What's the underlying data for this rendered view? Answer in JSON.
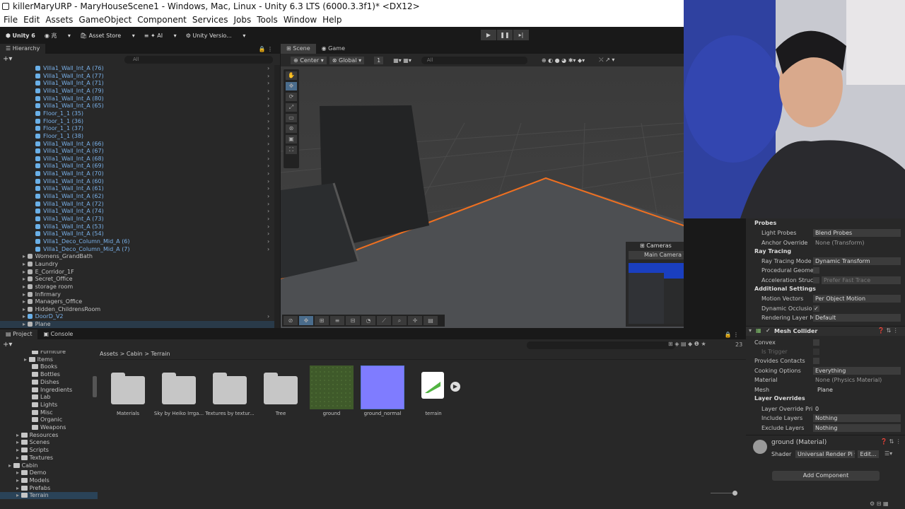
{
  "window": {
    "title": "killerMaryURP - MaryHouseScene1 - Windows, Mac, Linux - Unity 6.3 LTS (6000.3.3f1)* <DX12>"
  },
  "menu": [
    "File",
    "Edit",
    "Assets",
    "GameObject",
    "Component",
    "Services",
    "Jobs",
    "Tools",
    "Window",
    "Help"
  ],
  "toolbar": {
    "unity": "Unity 6",
    "account": "兆",
    "store": "Asset Store",
    "ai": "AI",
    "vcs": "Unity Versio..."
  },
  "hierarchy": {
    "tab": "Hierarchy",
    "search_placeholder": "All",
    "rows": [
      {
        "label": "Villa1_Wall_Int_A (76)",
        "type": "prefab"
      },
      {
        "label": "Villa1_Wall_Int_A (77)",
        "type": "prefab"
      },
      {
        "label": "Villa1_Wall_Int_A (71)",
        "type": "prefab"
      },
      {
        "label": "Villa1_Wall_Int_A (79)",
        "type": "prefab"
      },
      {
        "label": "Villa1_Wall_Int_A (80)",
        "type": "prefab"
      },
      {
        "label": "Villa1_Wall_Int_A (65)",
        "type": "prefab"
      },
      {
        "label": "Floor_1_1 (35)",
        "type": "prefab"
      },
      {
        "label": "Floor_1_1 (36)",
        "type": "prefab"
      },
      {
        "label": "Floor_1_1 (37)",
        "type": "prefab"
      },
      {
        "label": "Floor_1_1 (38)",
        "type": "prefab"
      },
      {
        "label": "Villa1_Wall_Int_A (66)",
        "type": "prefab"
      },
      {
        "label": "Villa1_Wall_Int_A (67)",
        "type": "prefab"
      },
      {
        "label": "Villa1_Wall_Int_A (68)",
        "type": "prefab"
      },
      {
        "label": "Villa1_Wall_Int_A (69)",
        "type": "prefab"
      },
      {
        "label": "Villa1_Wall_Int_A (70)",
        "type": "prefab"
      },
      {
        "label": "Villa1_Wall_Int_A (60)",
        "type": "prefab"
      },
      {
        "label": "Villa1_Wall_Int_A (61)",
        "type": "prefab"
      },
      {
        "label": "Villa1_Wall_Int_A (62)",
        "type": "prefab"
      },
      {
        "label": "Villa1_Wall_Int_A (72)",
        "type": "prefab"
      },
      {
        "label": "Villa1_Wall_Int_A (74)",
        "type": "prefab"
      },
      {
        "label": "Villa1_Wall_Int_A (73)",
        "type": "prefab"
      },
      {
        "label": "Villa1_Wall_Int_A (53)",
        "type": "prefab"
      },
      {
        "label": "Villa1_Wall_Int_A (54)",
        "type": "prefab"
      },
      {
        "label": "Villa1_Deco_Column_Mid_A (6)",
        "type": "prefab"
      },
      {
        "label": "Villa1_Deco_Column_Mid_A (7)",
        "type": "prefab"
      },
      {
        "label": "Womens_GrandBath",
        "type": "object"
      },
      {
        "label": "Laundry",
        "type": "object"
      },
      {
        "label": "E_Corridor_1F",
        "type": "object"
      },
      {
        "label": "Secret_Office",
        "type": "object"
      },
      {
        "label": "storage room",
        "type": "object"
      },
      {
        "label": "Infirmary",
        "type": "object"
      },
      {
        "label": "Managers_Office",
        "type": "object"
      },
      {
        "label": "Hidden_ChildrensRoom",
        "type": "object"
      },
      {
        "label": "DoorD_V2",
        "type": "prefab"
      },
      {
        "label": "Plane",
        "type": "object"
      }
    ]
  },
  "scene": {
    "tabs": [
      "Scene",
      "Game"
    ],
    "pivot": "Center",
    "space": "Global",
    "grid_snap": "1",
    "search_placeholder": "All",
    "cameras_overlay": {
      "title": "Cameras",
      "selected": "Main Camera"
    }
  },
  "project": {
    "tabs": [
      "Project",
      "Console"
    ],
    "breadcrumb": [
      "Assets",
      "Cabin",
      "Terrain"
    ],
    "count": "23",
    "tree": [
      {
        "label": "Furniture",
        "depth": 3
      },
      {
        "label": "Items",
        "depth": 2
      },
      {
        "label": "Books",
        "depth": 3
      },
      {
        "label": "Bottles",
        "depth": 3
      },
      {
        "label": "Dishes",
        "depth": 3
      },
      {
        "label": "Ingredients",
        "depth": 3
      },
      {
        "label": "Lab",
        "depth": 3
      },
      {
        "label": "Lights",
        "depth": 3
      },
      {
        "label": "Misc",
        "depth": 3
      },
      {
        "label": "Organic",
        "depth": 3
      },
      {
        "label": "Weapons",
        "depth": 3
      },
      {
        "label": "Resources",
        "depth": 1
      },
      {
        "label": "Scenes",
        "depth": 1
      },
      {
        "label": "Scripts",
        "depth": 1
      },
      {
        "label": "Textures",
        "depth": 1
      },
      {
        "label": "Cabin",
        "depth": 0
      },
      {
        "label": "Demo",
        "depth": 1
      },
      {
        "label": "Models",
        "depth": 1
      },
      {
        "label": "Prefabs",
        "depth": 1
      },
      {
        "label": "Terrain",
        "depth": 1
      }
    ],
    "assets": [
      {
        "label": "Materials",
        "kind": "folder"
      },
      {
        "label": "Sky by Heiko Irrga...",
        "kind": "folder"
      },
      {
        "label": "Textures by textur...",
        "kind": "folder"
      },
      {
        "label": "Tree",
        "kind": "folder"
      },
      {
        "label": "ground",
        "kind": "texture-grass"
      },
      {
        "label": "ground_normal",
        "kind": "texture-normal"
      },
      {
        "label": "terrain",
        "kind": "terrain-data"
      }
    ]
  },
  "inspector": {
    "probes": {
      "section": "Probes",
      "light_probes_label": "Light Probes",
      "light_probes": "Blend Probes",
      "anchor_label": "Anchor Override",
      "anchor": "None (Transform)"
    },
    "ray_tracing": {
      "section": "Ray Tracing",
      "mode_label": "Ray Tracing Mode",
      "mode": "Dynamic Transform",
      "procedural_label": "Procedural Geome",
      "accel_label": "Acceleration Struc",
      "accel": "Prefer Fast Trace"
    },
    "additional": {
      "section": "Additional Settings",
      "motion_label": "Motion Vectors",
      "motion": "Per Object Motion",
      "dynamic_label": "Dynamic Occlusio",
      "layer_label": "Rendering Layer M",
      "layer": "Default"
    },
    "mesh_collider": {
      "title": "Mesh Collider",
      "convex_label": "Convex",
      "trigger_label": "Is Trigger",
      "contacts_label": "Provides Contacts",
      "cooking_label": "Cooking Options",
      "cooking": "Everything",
      "material_label": "Material",
      "material": "None (Physics Material)",
      "mesh_label": "Mesh",
      "mesh": "Plane"
    },
    "layer_overrides": {
      "section": "Layer Overrides",
      "priority_label": "Layer Override Pri",
      "priority": "0",
      "include_label": "Include Layers",
      "include": "Nothing",
      "exclude_label": "Exclude Layers",
      "exclude": "Nothing"
    },
    "material": {
      "title": "ground (Material)",
      "shader_label": "Shader",
      "shader": "Universal Render Pi",
      "edit": "Edit..."
    },
    "add_component": "Add Component"
  }
}
